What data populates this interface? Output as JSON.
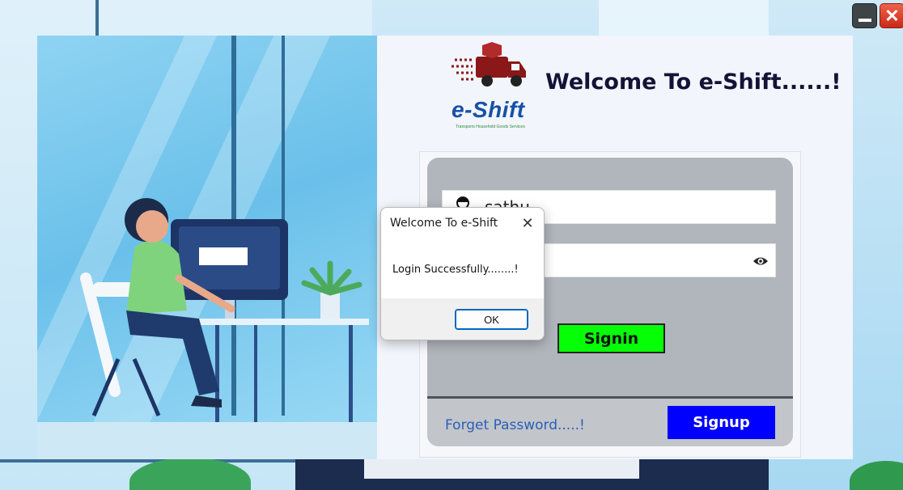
{
  "window_controls": {
    "close_glyph": "✕"
  },
  "app": {
    "logo_text": "e-Shift",
    "logo_subtext": "Transports Household Goods Services",
    "title": "Welcome To e-Shift......!"
  },
  "login": {
    "username_value": "sathu",
    "signin_label": "Signin",
    "forget_label": "Forget Password.....!",
    "signup_label": "Signup"
  },
  "dialog": {
    "title": "Welcome To e-Shift",
    "close_glyph": "✕",
    "message": "Login Successfully........!",
    "ok_label": "OK"
  },
  "colors": {
    "signin": "#06ff06",
    "signup": "#0000ff",
    "panel": "#b1b5bc",
    "title": "#141236"
  }
}
